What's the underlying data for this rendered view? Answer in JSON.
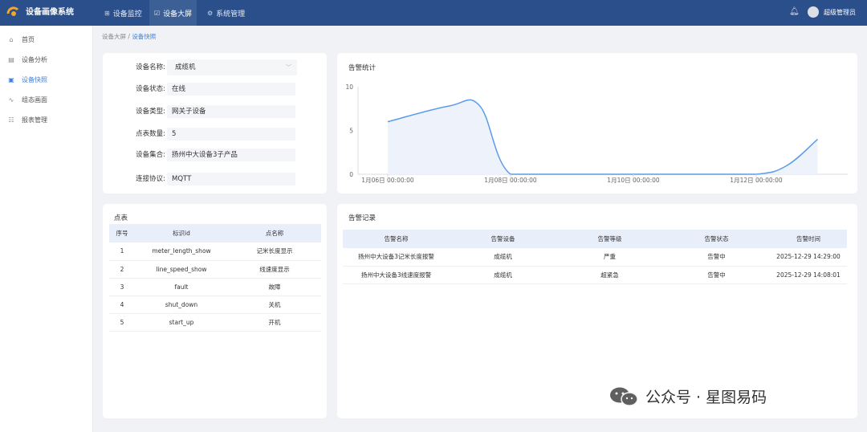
{
  "app": {
    "title": "设备画像系统"
  },
  "topnav": [
    {
      "icon": "grid-icon",
      "label": "设备监控"
    },
    {
      "icon": "checkbox-icon",
      "label": "设备大屏"
    },
    {
      "icon": "gear-icon",
      "label": "系统管理"
    }
  ],
  "user": {
    "name": "超级管理员"
  },
  "sidebar": [
    {
      "icon": "home-icon",
      "label": "首页"
    },
    {
      "icon": "chart-icon",
      "label": "设备分析"
    },
    {
      "icon": "camera-icon",
      "label": "设备快照"
    },
    {
      "icon": "wave-icon",
      "label": "组态画面"
    },
    {
      "icon": "table-icon",
      "label": "报表管理"
    }
  ],
  "breadcrumb": {
    "root": "设备大屏",
    "sep": "/",
    "current": "设备快照"
  },
  "device_info": [
    {
      "label": "设备名称:",
      "value": "成缆机"
    },
    {
      "label": "设备状态:",
      "value": "在线"
    },
    {
      "label": "设备类型:",
      "value": "网关子设备"
    },
    {
      "label": "点表数量:",
      "value": "5"
    },
    {
      "label": "设备集合:",
      "value": "扬州中大设备3子产品"
    },
    {
      "label": "连接协议:",
      "value": "MQTT"
    }
  ],
  "alarm_stats": {
    "title": "告警统计"
  },
  "chart_data": {
    "type": "area",
    "title": "告警统计",
    "x": [
      "1月06日 00:00:00",
      "1月07日 00:00:00",
      "1月07日 12:00:00",
      "1月08日 00:00:00",
      "1月09日 00:00:00",
      "1月10日 00:00:00",
      "1月11日 00:00:00",
      "1月12日 00:00:00",
      "1月12日 12:00:00",
      "1月13日 00:00:00"
    ],
    "values": [
      6,
      7.8,
      7.8,
      0,
      0,
      0,
      0,
      0,
      1,
      4
    ],
    "x_tick_labels": [
      "1月06日 00:00:00",
      "1月08日 00:00:00",
      "1月10日 00:00:00",
      "1月12日 00:00:00"
    ],
    "y_ticks": [
      0,
      5,
      10
    ],
    "ylim": [
      0,
      10
    ],
    "color": "#5b9bea",
    "fill": "#eef3fb",
    "grid": false
  },
  "points": {
    "title": "点表",
    "columns": [
      "序号",
      "标识id",
      "点名称"
    ],
    "rows": [
      [
        "1",
        "meter_length_show",
        "记米长度显示"
      ],
      [
        "2",
        "line_speed_show",
        "线速度显示"
      ],
      [
        "3",
        "fault",
        "故障"
      ],
      [
        "4",
        "shut_down",
        "关机"
      ],
      [
        "5",
        "start_up",
        "开机"
      ]
    ]
  },
  "records": {
    "title": "告警记录",
    "columns": [
      "告警名称",
      "告警设备",
      "告警等级",
      "告警状态",
      "告警时间"
    ],
    "rows": [
      [
        "扬州中大设备3记米长度报警",
        "成缆机",
        "严重",
        "告警中",
        "2025-12-29 14:29:00"
      ],
      [
        "扬州中大设备3线速度报警",
        "成缆机",
        "超紧急",
        "告警中",
        "2025-12-29 14:08:01"
      ]
    ]
  },
  "watermark": {
    "text": "公众号 · 星图易码"
  }
}
